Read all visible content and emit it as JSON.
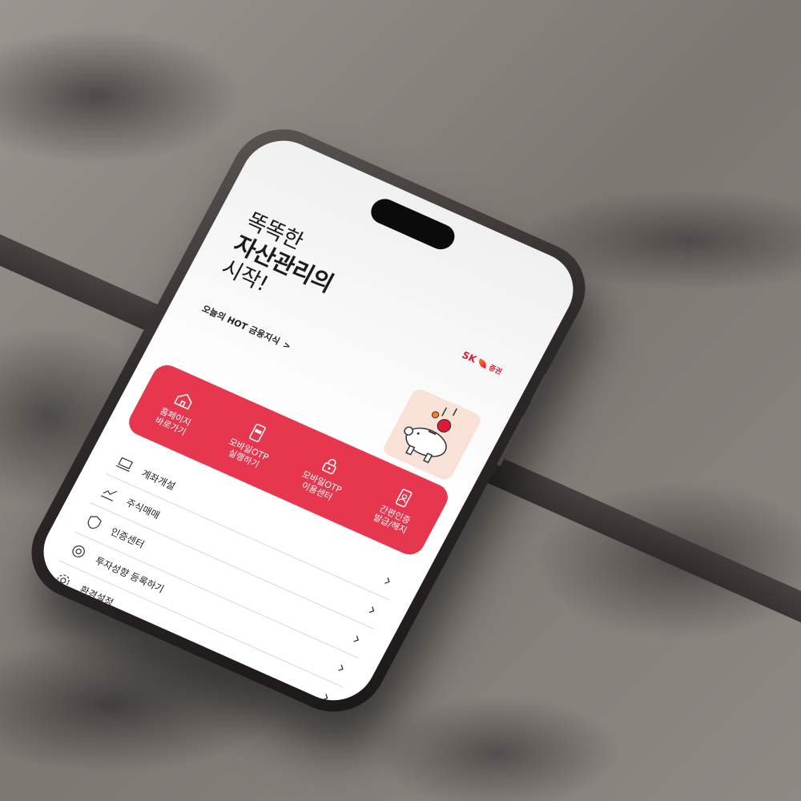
{
  "headline": {
    "line1": "똑똑한",
    "line2": "자산관리의",
    "line3": "시작!"
  },
  "brand": {
    "name": "SK",
    "sub": "증권"
  },
  "hot_link": {
    "label": "오늘의 HOT 금융지식",
    "arrow": ">"
  },
  "quick_menu": [
    {
      "label": "홈페이지\n바로가기",
      "icon": "home-icon"
    },
    {
      "label": "모바일OTP\n실행하기",
      "icon": "otp-icon"
    },
    {
      "label": "모바일OTP\n이용센터",
      "icon": "lock-icon"
    },
    {
      "label": "간편인증\n발급/해지",
      "icon": "id-card-icon"
    }
  ],
  "menu": [
    {
      "label": "계좌개설",
      "icon": "laptop-icon"
    },
    {
      "label": "주식매매",
      "icon": "chart-icon"
    },
    {
      "label": "인증센터",
      "icon": "shield-icon"
    },
    {
      "label": "투자성향 등록하기",
      "icon": "target-icon"
    },
    {
      "label": "환경설정",
      "icon": "gear-icon"
    }
  ],
  "colors": {
    "accent": "#e6374f",
    "brand_red": "#e31837",
    "brand_orange": "#f58220"
  }
}
